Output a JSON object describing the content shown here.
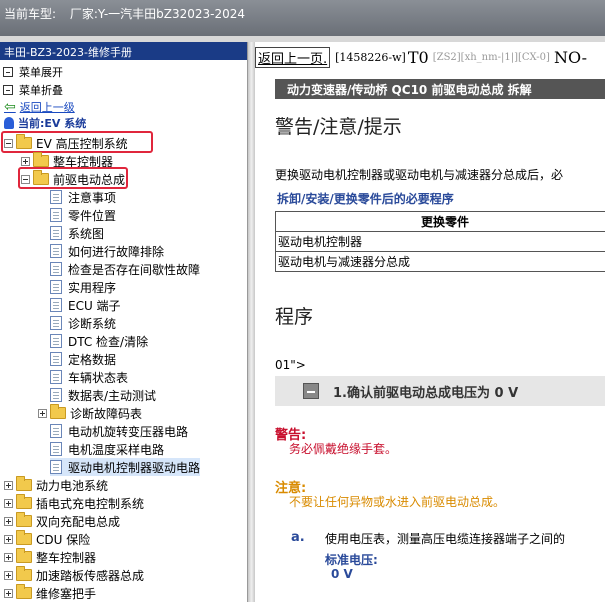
{
  "window": {
    "car_label": "当前车型:",
    "car_value": "厂家:Y-一汽丰田bZ32023-2024"
  },
  "sidebar": {
    "header": "丰田-BZ3-2023-维修手册",
    "expand_all": "菜单展开",
    "collapse_all": "菜单折叠",
    "back": "返回上一级",
    "current": "当前:EV 系统",
    "tree": [
      {
        "label": "EV 高压控制系统",
        "level": 0,
        "kind": "folder",
        "expander": "minus",
        "highlight": true
      },
      {
        "label": "整车控制器",
        "level": 1,
        "kind": "folder",
        "expander": "plus"
      },
      {
        "label": "前驱电动总成",
        "level": 1,
        "kind": "folder",
        "expander": "minus",
        "highlight": true
      },
      {
        "label": "注意事项",
        "level": 2,
        "kind": "doc"
      },
      {
        "label": "零件位置",
        "level": 2,
        "kind": "doc"
      },
      {
        "label": "系统图",
        "level": 2,
        "kind": "doc"
      },
      {
        "label": "如何进行故障排除",
        "level": 2,
        "kind": "doc"
      },
      {
        "label": "检查是否存在间歇性故障",
        "level": 2,
        "kind": "doc"
      },
      {
        "label": "实用程序",
        "level": 2,
        "kind": "doc"
      },
      {
        "label": "ECU 端子",
        "level": 2,
        "kind": "doc"
      },
      {
        "label": "诊断系统",
        "level": 2,
        "kind": "doc"
      },
      {
        "label": "DTC 检查/清除",
        "level": 2,
        "kind": "doc"
      },
      {
        "label": "定格数据",
        "level": 2,
        "kind": "doc"
      },
      {
        "label": "车辆状态表",
        "level": 2,
        "kind": "doc"
      },
      {
        "label": "数据表/主动测试",
        "level": 2,
        "kind": "doc"
      },
      {
        "label": "诊断故障码表",
        "level": 2,
        "kind": "folder",
        "expander": "plus"
      },
      {
        "label": "电动机旋转变压器电路",
        "level": 2,
        "kind": "doc"
      },
      {
        "label": "电机温度采样电路",
        "level": 2,
        "kind": "doc"
      },
      {
        "label": "驱动电机控制器驱动电路",
        "level": 2,
        "kind": "doc",
        "selected": true
      },
      {
        "label": "动力电池系统",
        "level": 0,
        "kind": "folder",
        "expander": "plus"
      },
      {
        "label": "插电式充电控制系统",
        "level": 0,
        "kind": "folder",
        "expander": "plus"
      },
      {
        "label": "双向充配电总成",
        "level": 0,
        "kind": "folder",
        "expander": "plus"
      },
      {
        "label": "CDU 保险",
        "level": 0,
        "kind": "folder",
        "expander": "plus"
      },
      {
        "label": "整车控制器",
        "level": 0,
        "kind": "folder",
        "expander": "plus"
      },
      {
        "label": "加速踏板传感器总成",
        "level": 0,
        "kind": "folder",
        "expander": "plus"
      },
      {
        "label": "维修塞把手",
        "level": 0,
        "kind": "folder",
        "expander": "plus"
      }
    ]
  },
  "content": {
    "prev_link": "返回上一页.",
    "code": "[1458226-w]",
    "t0": "T0",
    "zs": "[ZS2][xh_nm-|1|][CX-0]",
    "no": "NO-",
    "section": "动力变速器/传动桥 QC10 前驱电动总成 拆解",
    "warn_title": "警告/注意/提示",
    "intro": "更换驱动电机控制器或驱动电机与减速器分总成后，必",
    "proc_link": "拆卸/安装/更换零件后的必要程序",
    "table": {
      "header": "更换零件",
      "rows": [
        "驱动电机控制器",
        "驱动电机与减速器分总成"
      ]
    },
    "proc_title": "程序",
    "stray": "01\">",
    "step": "1.确认前驱电动总成电压为 0 V",
    "warning_label": "警告:",
    "warning_text": "务必佩戴绝缘手套。",
    "caution_label": "注意:",
    "caution_text": "不要让任何异物或水进入前驱电动总成。",
    "substep_letter": "a.",
    "substep_text": "使用电压表，测量高压电缆连接器端子之间的",
    "std_label": "标准电压:",
    "std_value": "0 V"
  }
}
